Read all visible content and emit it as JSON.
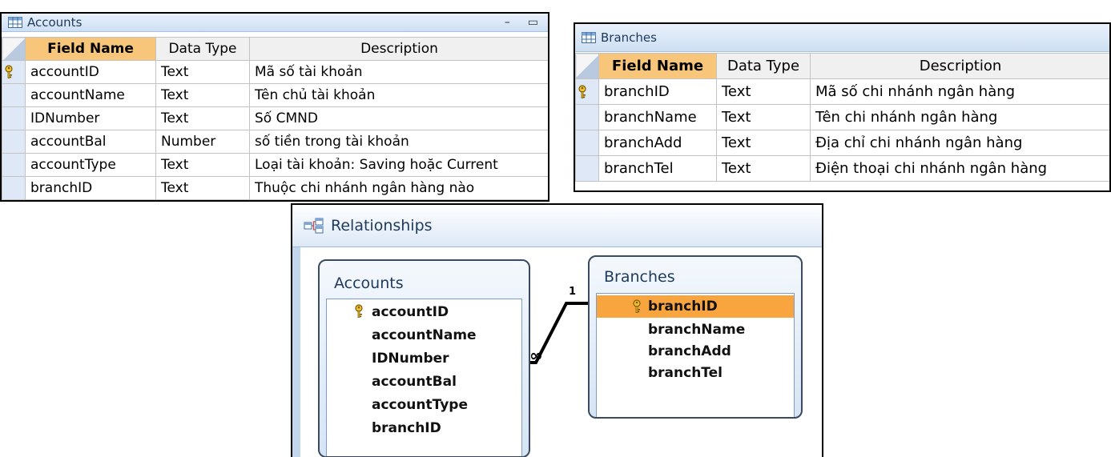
{
  "accounts_table": {
    "title": "Accounts",
    "headers": [
      "Field Name",
      "Data Type",
      "Description"
    ],
    "rows": [
      {
        "field": "accountID",
        "type": "Text",
        "desc": "Mã số tài khoản",
        "key": true
      },
      {
        "field": "accountName",
        "type": "Text",
        "desc": "Tên chủ tài khoản"
      },
      {
        "field": "IDNumber",
        "type": "Text",
        "desc": "Số CMND"
      },
      {
        "field": "accountBal",
        "type": "Number",
        "desc": "số tiền trong tài khoản"
      },
      {
        "field": "accountType",
        "type": "Text",
        "desc": "Loại tài khoản: Saving hoặc Current"
      },
      {
        "field": "branchID",
        "type": "Text",
        "desc": "Thuộc chi nhánh ngân hàng nào"
      }
    ],
    "minimize_glyph": "–",
    "restore_glyph": "▭"
  },
  "branches_table": {
    "title": "Branches",
    "headers": [
      "Field Name",
      "Data Type",
      "Description"
    ],
    "rows": [
      {
        "field": "branchID",
        "type": "Text",
        "desc": "Mã số chi nhánh ngân hàng",
        "key": true
      },
      {
        "field": "branchName",
        "type": "Text",
        "desc": "Tên chi nhánh ngân hàng"
      },
      {
        "field": "branchAdd",
        "type": "Text",
        "desc": "Địa chỉ chi nhánh ngân hàng"
      },
      {
        "field": "branchTel",
        "type": "Text",
        "desc": "Điện thoại chi nhánh ngân hàng"
      }
    ]
  },
  "relationships": {
    "title": "Relationships",
    "accounts": {
      "title": "Accounts",
      "fields": [
        "accountID",
        "accountName",
        "IDNumber",
        "accountBal",
        "accountType",
        "branchID"
      ]
    },
    "branches": {
      "title": "Branches",
      "fields": [
        "branchID",
        "branchName",
        "branchAdd",
        "branchTel"
      ]
    },
    "one_label": "1",
    "many_label": "∞"
  },
  "colors": {
    "header_highlight": "#f8c67a",
    "selection": "#f8a540",
    "title_text": "#1e395b"
  },
  "icons": [
    "table-icon",
    "primary-key-icon",
    "relationships-icon"
  ]
}
